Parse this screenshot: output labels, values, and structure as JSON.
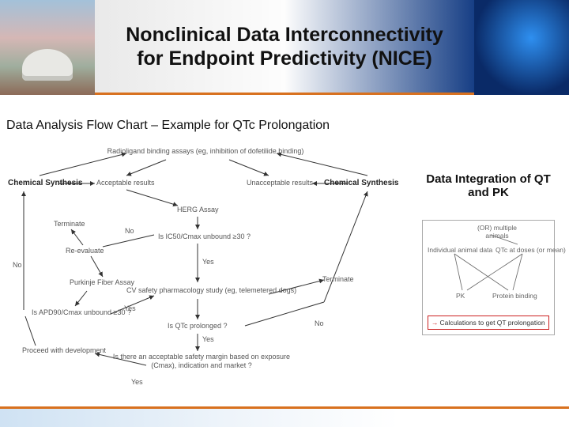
{
  "banner": {
    "title_line1": "Nonclinical Data Interconnectivity",
    "title_line2": "for Endpoint Predictivity (NICE)"
  },
  "section_title": "Data Analysis Flow Chart – Example for QTc Prolongation",
  "flow": {
    "top": "Radioligand binding assays (eg, inhibition of dofetilide binding)",
    "chem_left": "Chemical Synthesis",
    "chem_right": "Chemical Synthesis",
    "acceptable": "Acceptable results",
    "unacceptable": "Unacceptable results",
    "herg": "HERG Assay",
    "terminate_left": "Terminate",
    "terminate_right": "Terminate",
    "no_upper": "No",
    "no_lower": "No",
    "yes_mid": "Yes",
    "yes_low1": "Yes",
    "yes_low2": "Yes",
    "no_right": "No",
    "reeval": "Re-evaluate",
    "q_ic50": "Is IC50/Cmax unbound ≥30 ?",
    "purkinje": "Purkinje Fiber Assay",
    "q_apd90": "Is APD90/Cmax unbound ≥30 ?",
    "cv_safety": "CV safety pharmacology study (eg, telemetered dogs)",
    "q_qtc": "Is QTc prolonged ?",
    "q_margin": "Is there an acceptable safety margin based on exposure (Cmax), indication and market ?",
    "proceed": "Proceed with development"
  },
  "side": {
    "title": "Data Integration of QT and PK",
    "or_multi": "(OR) multiple animals",
    "indiv": "Individual animal data",
    "qtc_doses": "QTc at doses (or mean)",
    "pk": "PK",
    "protein": "Protein binding",
    "calc_label": "Calculations to get QT prolongation"
  }
}
